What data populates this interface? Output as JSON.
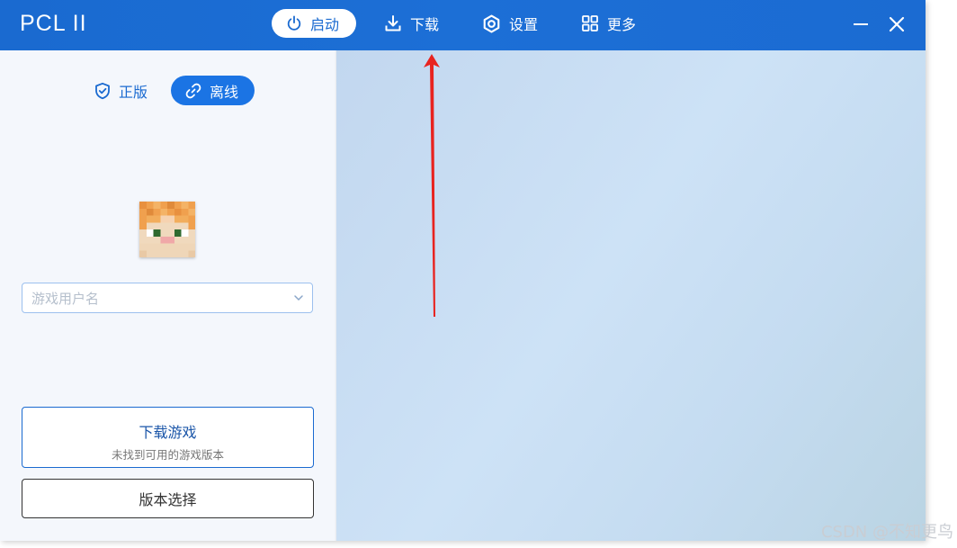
{
  "app": {
    "title": "PCL II"
  },
  "nav": {
    "launch": "启动",
    "download": "下载",
    "settings": "设置",
    "more": "更多"
  },
  "login": {
    "official_tab": "正版",
    "offline_tab": "离线",
    "username_placeholder": "游戏用户名"
  },
  "actions": {
    "download_game": "下载游戏",
    "download_game_sub": "未找到可用的游戏版本",
    "version_select": "版本选择"
  },
  "watermark": "CSDN @不知更鸟",
  "colors": {
    "titlebar": "#1b6bd2",
    "accent": "#1b74e4",
    "annotation_arrow": "#e8231f"
  },
  "icons": {
    "launch": "power-icon",
    "download": "download-icon",
    "settings": "gear-icon",
    "more": "grid-icon",
    "official": "shield-check-icon",
    "offline": "link-icon"
  }
}
